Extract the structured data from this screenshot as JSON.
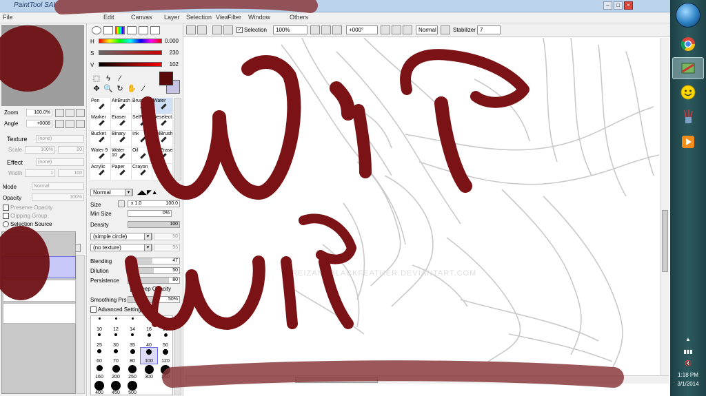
{
  "app": {
    "title": "PaintTool SAI",
    "menu": [
      "File",
      "Edit",
      "Canvas",
      "Layer",
      "Selection",
      "Filter",
      "View",
      "Window",
      "Others"
    ]
  },
  "navigator": {
    "zoom_label": "Zoom",
    "zoom_value": "100.0%",
    "angle_label": "Angle",
    "angle_value": "+0008"
  },
  "layer_props": {
    "texture_label": "Texture",
    "texture_value": "(none)",
    "scale_label": "Scale",
    "scale_value": "100%",
    "scale_num": "20",
    "effect_label": "Effect",
    "effect_value": "(none)",
    "width_label": "Width",
    "width_value": "1",
    "width_num": "100",
    "mode_label": "Mode",
    "mode_value": "Normal",
    "opacity_label": "Opacity",
    "opacity_value": "100%",
    "preserve_opacity": "Preserve Opacity",
    "clipping_group": "Clipping Group",
    "selection_source": "Selection Source"
  },
  "color": {
    "h_label": "H",
    "h_value": "0.000",
    "s_label": "S",
    "s_value": "230",
    "v_label": "V",
    "v_value": "102",
    "main_color": "#5b0a0c",
    "sub_color": "#c5c3e3"
  },
  "brushes": [
    {
      "label": "Pen"
    },
    {
      "label": "AirBrush"
    },
    {
      "label": "Brush"
    },
    {
      "label": "Water"
    },
    {
      "label": "Marker"
    },
    {
      "label": "Eraser"
    },
    {
      "label": "SelPen"
    },
    {
      "label": "Deselect"
    },
    {
      "label": "Bucket"
    },
    {
      "label": "Binary"
    },
    {
      "label": "Ink"
    },
    {
      "label": "SelBrush"
    },
    {
      "label": "Water 9"
    },
    {
      "label": "Water 10"
    },
    {
      "label": "Oil"
    },
    {
      "label": "SelErase"
    },
    {
      "label": "Acrylic"
    },
    {
      "label": "Paper"
    },
    {
      "label": "Crayon"
    },
    {
      "label": ""
    }
  ],
  "brush_settings": {
    "blend_mode": "Normal",
    "size_label": "Size",
    "size_mult": "x 1.0",
    "size_value": "100.0",
    "min_size_label": "Min Size",
    "min_size_value": "0%",
    "density_label": "Density",
    "density_value": "100",
    "shape": "(simple circle)",
    "shape_num": "50",
    "texture": "(no texture)",
    "texture_num": "95",
    "blending_label": "Blending",
    "blending_value": "47",
    "dilution_label": "Dilution",
    "dilution_value": "50",
    "persistence_label": "Persistence",
    "persistence_value": "80",
    "keep_opacity": "Keep Opacity",
    "smoothing_label": "Smoothing Prs",
    "smoothing_value": "50%",
    "advanced": "Advanced Settings",
    "sizes": [
      "10",
      "12",
      "14",
      "16",
      "20",
      "25",
      "30",
      "35",
      "40",
      "50",
      "60",
      "70",
      "80",
      "100",
      "120",
      "160",
      "200",
      "250",
      "300",
      "350",
      "400",
      "450",
      "500"
    ],
    "selected_size": "100"
  },
  "toolbar": {
    "selection_label": "Selection",
    "zoom": "100%",
    "angle": "+000°",
    "mode": "Normal",
    "stabilizer_label": "Stabilizer",
    "stabilizer_value": "7"
  },
  "overlay": {
    "text_big": "WiP",
    "text_small": "WiP",
    "stroke_color": "#7a1216",
    "watermark": "© REIZANDBLACKFEATHER.DEVIANTART.COM"
  },
  "taskbar": {
    "time": "1:18 PM",
    "date": "3/1/2014",
    "apps": [
      "chrome-icon",
      "painttool-icon",
      "smiley-icon",
      "paintbrush-icon",
      "media-player-icon"
    ]
  }
}
